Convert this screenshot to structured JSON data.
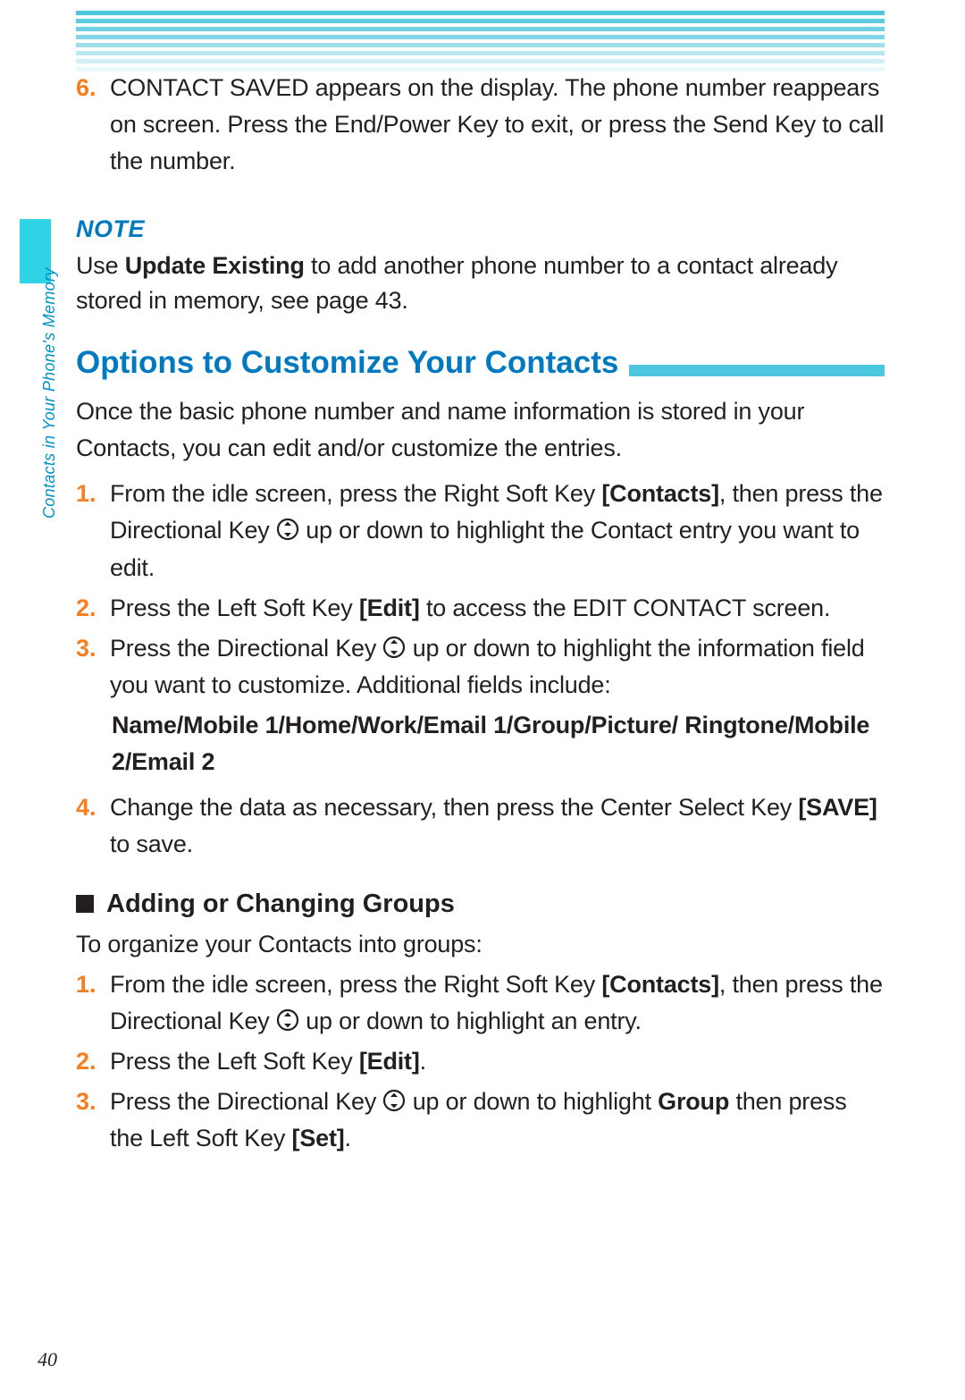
{
  "colors": {
    "accent_cyan": "#4cc6dd",
    "accent_blue": "#0079c1",
    "accent_orange": "#f57f20"
  },
  "side_label": "Contacts in Your Phone's Memory",
  "step6": {
    "num": "6.",
    "text": "CONTACT SAVED appears on the display. The phone number reappears on screen. Press the End/Power Key to exit, or press the Send Key to call the number."
  },
  "note": {
    "label": "NOTE",
    "pre": "Use ",
    "bold": "Update Existing",
    "post": " to add another phone number to a contact already stored in memory, see page 43."
  },
  "section_title": "Options to Customize Your Contacts",
  "section_intro": "Once the basic phone number and name information is stored in your Contacts, you can edit and/or customize the entries.",
  "customize": {
    "s1": {
      "num": "1.",
      "a": "From the idle screen, press the Right Soft Key ",
      "b": "[Contacts]",
      "c": ", then press the Directional Key ",
      "d": " up or down to highlight the Contact entry you want to edit."
    },
    "s2": {
      "num": "2.",
      "a": "Press the Left Soft Key ",
      "b": "[Edit]",
      "c": " to access the EDIT CONTACT screen."
    },
    "s3": {
      "num": "3.",
      "a": "Press the Directional Key ",
      "b": " up or down to highlight the information field you want to customize. Additional fields include:"
    },
    "fields": "Name/Mobile 1/Home/Work/Email 1/Group/Picture/ Ringtone/Mobile 2/Email 2",
    "s4": {
      "num": "4.",
      "a": "Change the data as necessary, then press the Center Select Key ",
      "b": "[SAVE]",
      "c": " to save."
    }
  },
  "sub_heading": "Adding or Changing Groups",
  "groups_intro": "To organize your Contacts into groups:",
  "groups": {
    "s1": {
      "num": "1.",
      "a": "From the idle screen, press the Right Soft Key ",
      "b": "[Contacts]",
      "c": ", then press the Directional Key ",
      "d": " up or down to highlight an entry."
    },
    "s2": {
      "num": "2.",
      "a": "Press the Left Soft Key ",
      "b": "[Edit]",
      "c": "."
    },
    "s3": {
      "num": "3.",
      "a": "Press the Directional Key ",
      "b": " up or down to highlight ",
      "c": "Group",
      "d": " then press the Left Soft Key ",
      "e": "[Set]",
      "f": "."
    }
  },
  "page_number": "40"
}
